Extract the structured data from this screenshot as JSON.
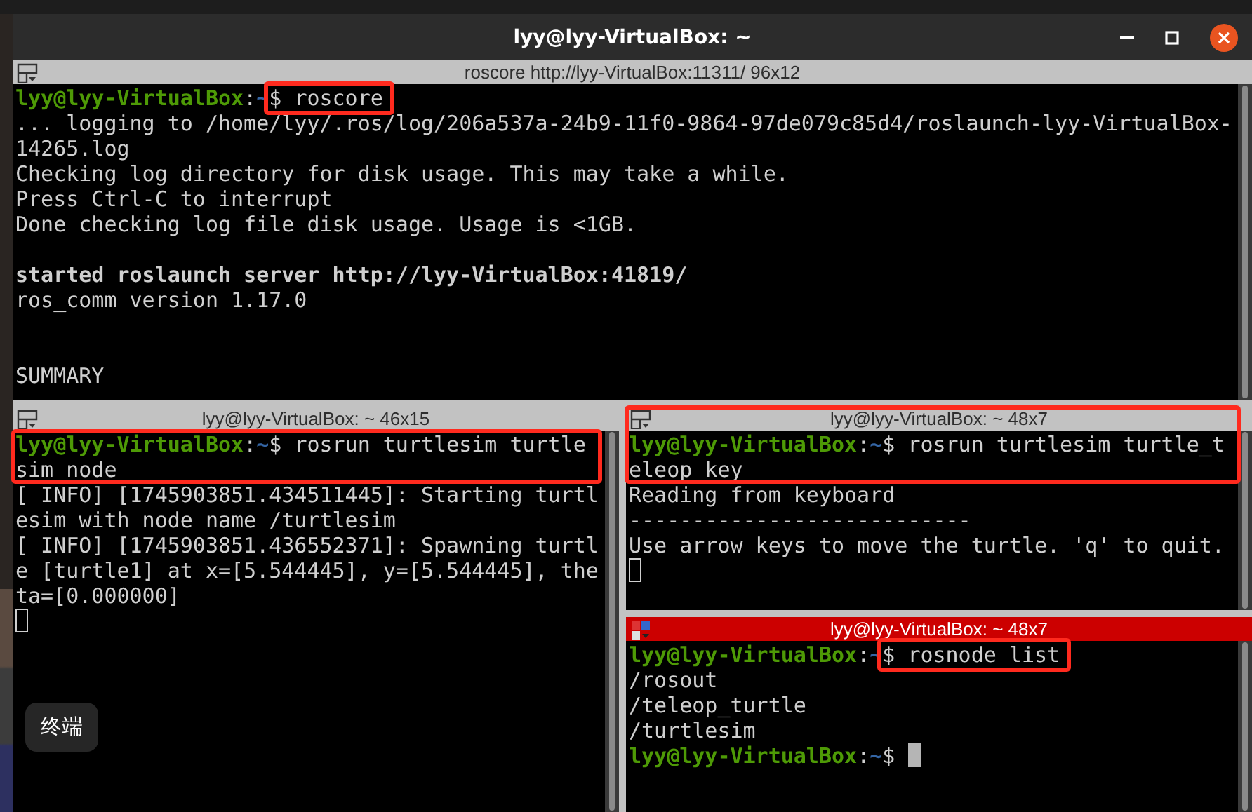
{
  "window": {
    "title": "lyy@lyy-VirtualBox: ~"
  },
  "panes": [
    {
      "title": "roscore http://lyy-VirtualBox:11311/ 96x12",
      "active": false,
      "lines": [
        {
          "kind": "prompt",
          "user": "lyy@lyy-VirtualBox",
          "sep": ":",
          "path": "~",
          "sign": "$",
          "command": "roscore",
          "boxed_command": true
        },
        {
          "kind": "output",
          "text": "... logging to /home/lyy/.ros/log/206a537a-24b9-11f0-9864-97de079c85d4/roslaunch-lyy-VirtualBox-14265.log"
        },
        {
          "kind": "output",
          "text": "Checking log directory for disk usage. This may take a while."
        },
        {
          "kind": "output",
          "text": "Press Ctrl-C to interrupt"
        },
        {
          "kind": "output",
          "text": "Done checking log file disk usage. Usage is <1GB."
        },
        {
          "kind": "blank"
        },
        {
          "kind": "output",
          "text": "started roslaunch server http://lyy-VirtualBox:41819/",
          "bold": true
        },
        {
          "kind": "output",
          "text": "ros_comm version 1.17.0"
        },
        {
          "kind": "blank"
        },
        {
          "kind": "blank"
        },
        {
          "kind": "output",
          "text": "SUMMARY"
        }
      ]
    },
    {
      "title": "lyy@lyy-VirtualBox: ~ 46x15",
      "active": false,
      "lines": [
        {
          "kind": "prompt",
          "user": "lyy@lyy-VirtualBox",
          "sep": ":",
          "path": "~",
          "sign": "$",
          "command": "rosrun turtlesim turtlesim_node",
          "boxed_line": true
        },
        {
          "kind": "output",
          "text": "[ INFO] [1745903851.434511445]: Starting turtlesim with node name /turtlesim"
        },
        {
          "kind": "output",
          "text": "[ INFO] [1745903851.436552371]: Spawning turtle [turtle1] at x=[5.544445], y=[5.544445], theta=[0.000000]"
        },
        {
          "kind": "cursor"
        }
      ]
    },
    {
      "title": "lyy@lyy-VirtualBox: ~ 48x7",
      "active": false,
      "boxed_header": true,
      "lines": [
        {
          "kind": "prompt",
          "user": "lyy@lyy-VirtualBox",
          "sep": ":",
          "path": "~",
          "sign": "$",
          "command": "rosrun turtlesim turtle_teleop_key",
          "boxed_line": true
        },
        {
          "kind": "output",
          "text": "Reading from keyboard"
        },
        {
          "kind": "output",
          "text": "---------------------------"
        },
        {
          "kind": "output",
          "text": "Use arrow keys to move the turtle. 'q' to quit."
        },
        {
          "kind": "cursor"
        }
      ]
    },
    {
      "title": "lyy@lyy-VirtualBox: ~ 48x7",
      "active": true,
      "lines": [
        {
          "kind": "prompt",
          "user": "lyy@lyy-VirtualBox",
          "sep": ":",
          "path": "~",
          "sign": "$",
          "command": "rosnode list",
          "boxed_command": true
        },
        {
          "kind": "output",
          "text": "/rosout"
        },
        {
          "kind": "output",
          "text": "/teleop_turtle"
        },
        {
          "kind": "output",
          "text": "/turtlesim"
        },
        {
          "kind": "prompt",
          "user": "lyy@lyy-VirtualBox",
          "sep": ":",
          "path": "~",
          "sign": "$",
          "cursor": true
        }
      ]
    }
  ],
  "tooltip": "终端"
}
